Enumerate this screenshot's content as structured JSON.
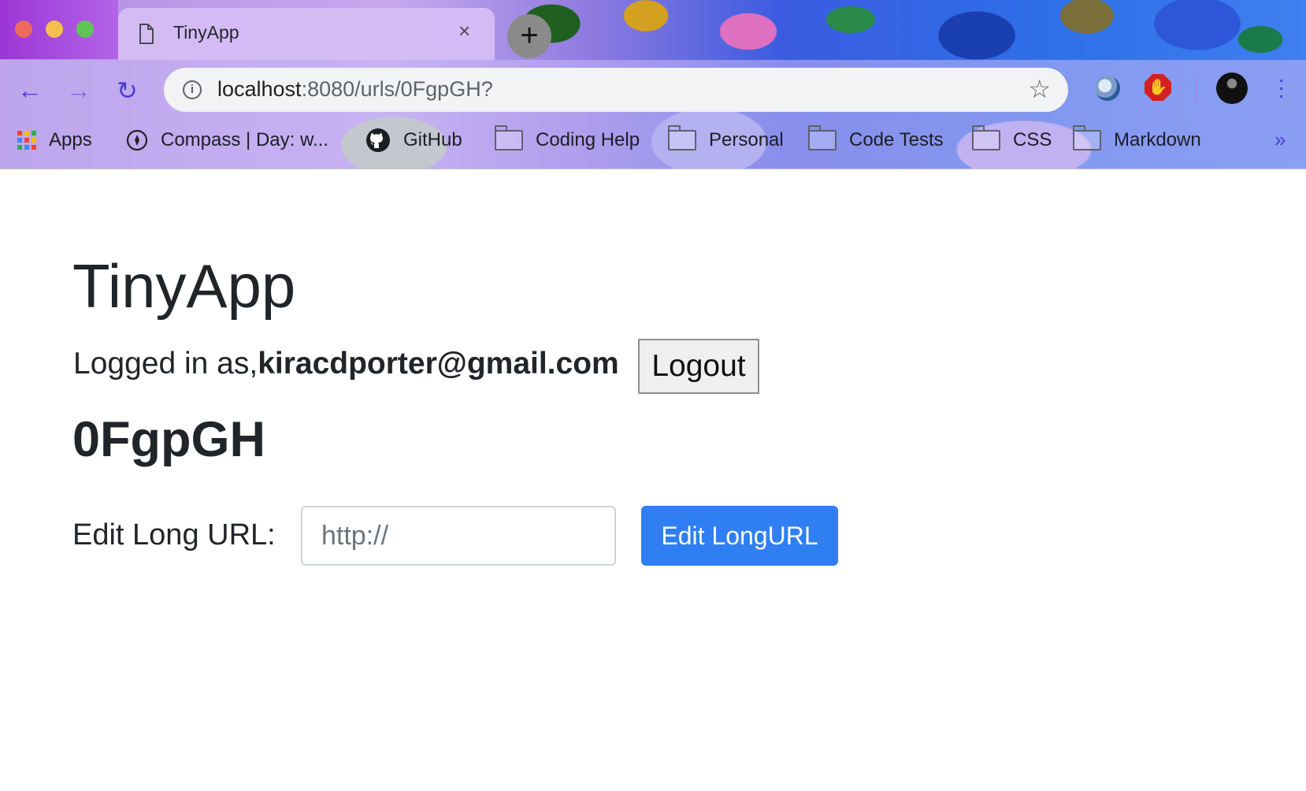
{
  "browser": {
    "tab": {
      "title": "TinyApp",
      "close_glyph": "×"
    },
    "new_tab_glyph": "+",
    "nav": {
      "back_glyph": "←",
      "forward_glyph": "→",
      "reload_glyph": "↻"
    },
    "address": {
      "host": "localhost",
      "rest": ":8080/urls/0FgpGH?"
    },
    "bookmarks": [
      {
        "label": "Apps",
        "icon": "apps-grid-icon"
      },
      {
        "label": "Compass | Day: w...",
        "icon": "compass-icon"
      },
      {
        "label": "GitHub",
        "icon": "github-icon"
      },
      {
        "label": "Coding Help",
        "icon": "folder-icon"
      },
      {
        "label": "Personal",
        "icon": "folder-icon"
      },
      {
        "label": "Code Tests",
        "icon": "folder-icon"
      },
      {
        "label": "CSS",
        "icon": "folder-icon"
      },
      {
        "label": "Markdown",
        "icon": "folder-icon"
      }
    ],
    "overflow_glyph": "»",
    "colors": {
      "accent": "#4a3ed0",
      "omnibox_bg": "#f1f3f4"
    }
  },
  "page": {
    "title": "TinyApp",
    "logged_in_prefix": "Logged in as,",
    "user_email": "kiracdporter@gmail.com",
    "logout_label": "Logout",
    "short_url_id": "0FgpGH",
    "edit_label": "Edit Long URL:",
    "long_url_placeholder": "http://",
    "edit_button_label": "Edit LongURL",
    "colors": {
      "primary_button": "#2f7ff2",
      "text": "#212529"
    }
  }
}
